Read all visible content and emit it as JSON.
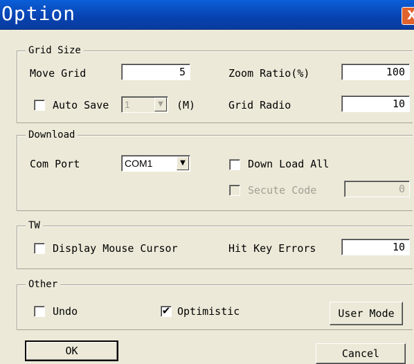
{
  "window": {
    "title": "Option",
    "close_glyph": "X"
  },
  "grid_size": {
    "legend": "Grid Size",
    "move_grid_label": "Move Grid",
    "move_grid_value": "5",
    "zoom_ratio_label": "Zoom Ratio(%)",
    "zoom_ratio_value": "100",
    "auto_save_label": "Auto Save",
    "auto_save_checked": false,
    "auto_save_select_value": "1",
    "auto_save_unit": "(M)",
    "grid_radio_label": "Grid Radio",
    "grid_radio_value": "10"
  },
  "download": {
    "legend": "Download",
    "com_port_label": "Com Port",
    "com_port_value": "COM1",
    "down_load_all_label": "Down Load All",
    "down_load_all_checked": false,
    "secute_code_label": "Secute Code",
    "secute_code_value": "0"
  },
  "tw": {
    "legend": "TW",
    "display_mouse_cursor_label": "Display Mouse Cursor",
    "display_mouse_cursor_checked": false,
    "hit_key_errors_label": "Hit Key Errors",
    "hit_key_errors_value": "10"
  },
  "other": {
    "legend": "Other",
    "undo_label": "Undo",
    "undo_checked": false,
    "optimistic_label": "Optimistic",
    "optimistic_checked": true,
    "user_mode_label": "User Mode",
    "check_glyph": "✔"
  },
  "buttons": {
    "ok_label": "OK",
    "cancel_label": "Cancel"
  },
  "icons": {
    "dropdown_arrow": "▼"
  }
}
